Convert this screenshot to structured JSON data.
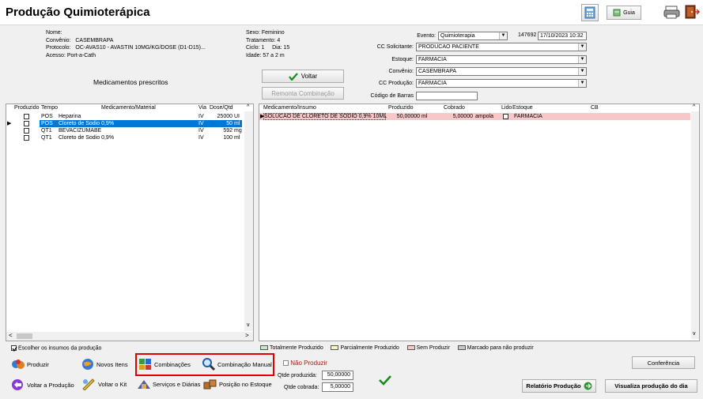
{
  "window": {
    "title": "Produção Quimioterápica"
  },
  "toolbar": {
    "guia_label": "Guia"
  },
  "patient": {
    "nome_label": "Nome:",
    "convenio_label": "Convênio:",
    "convenio": "CASEMBRAPA",
    "protocolo_label": "Protocolo:",
    "protocolo": "OC-AVAS10 - AVASTIN 10MG/KG/DOSE (D1-D15)...",
    "acesso": "Acesso: Port-a-Cath",
    "sexo": "Sexo: Feminino",
    "tratamento": "Tratamento: 4",
    "ciclo": "Ciclo: 1",
    "dia": "Dia: 15",
    "idade": "Idade: 57 a 2 m"
  },
  "form": {
    "evento_label": "Evento:",
    "evento": "Quimioterapia",
    "evento_num": "147692",
    "evento_datetime": "17/10/2023 10:32",
    "cc_solicitante_label": "CC Solicitante:",
    "cc_solicitante": "PRODUCAO PACIENTE",
    "estoque_label": "Estoque:",
    "estoque": "FARMACIA",
    "convenio_label": "Convênio:",
    "convenio": "CASEMBRAPA",
    "cc_producao_label": "CC Produção:",
    "cc_producao": "FARMACIA",
    "codigo_barras_label": "Código de Barras",
    "codigo_barras": ""
  },
  "buttons": {
    "voltar": "Voltar",
    "remonta": "Remonta Combinação",
    "produzir": "Produzir",
    "novos_itens": "Novos Itens",
    "combinacoes": "Combinações",
    "combinacao_manual": "Combinação Manual",
    "voltar_producao": "Voltar a Produção",
    "voltar_kit": "Voltar o Kit",
    "servicos_diarias": "Serviços e Diárias",
    "posicao_estoque": "Posição no Estoque",
    "conferencia": "Conferência",
    "relatorio_producao": "Relatório Produção",
    "visualiza_producao": "Visualiza produção do dia"
  },
  "left_panel": {
    "section_title": "Medicamentos prescritos",
    "columns": [
      "Produzido",
      "Tempo",
      "Medicamento/Material",
      "Via",
      "Dose/Qtd"
    ],
    "rows": [
      {
        "tempo": "POS",
        "medicamento": "Heparina",
        "via": "IV",
        "dose": "25000",
        "unit": "UI",
        "selected": false
      },
      {
        "tempo": "POS",
        "medicamento": "Cloreto de Sodio 0,9%",
        "via": "IV",
        "dose": "50",
        "unit": "ml",
        "selected": true
      },
      {
        "tempo": "QT1",
        "medicamento": "BEVACIZUMABE",
        "via": "IV",
        "dose": "592",
        "unit": "mg",
        "selected": false
      },
      {
        "tempo": "QT1",
        "medicamento": "Cloreto de Sodio 0,9%",
        "via": "IV",
        "dose": "100",
        "unit": "ml",
        "selected": false
      }
    ],
    "checkbox_label": "Escolher os insumos da produção"
  },
  "right_panel": {
    "columns": [
      "Medicamento/Insumo",
      "Produzido",
      "Cobrado",
      "Lido",
      "Estoque",
      "CB"
    ],
    "rows": [
      {
        "medicamento": "SOLUCAO DE CLORETO DE SODIO 0,9% 10ML",
        "produzido": "50,00000",
        "produzido_unit": "ml",
        "cobrado": "5,00000",
        "cobrado_unit": "ampola",
        "estoque": "FARMACIA",
        "cb": ""
      }
    ]
  },
  "legend": [
    {
      "label": "Totalmente Produzido",
      "color": "#c8e6c8"
    },
    {
      "label": "Parcialmente Produzido",
      "color": "#f4f4c0"
    },
    {
      "label": "Sem Produzir",
      "color": "#f8c8c8"
    },
    {
      "label": "Marcado para não produzir",
      "color": "#c8c8c8"
    }
  ],
  "production": {
    "nao_produzir_label": "Não Produzir",
    "qtde_produzida_label": "Qtde produzida:",
    "qtde_produzida": "50,00000",
    "qtde_cobrada_label": "Qtde cobrada:",
    "qtde_cobrada": "5,00000"
  },
  "colors": {
    "selection": "#0078d7",
    "unproduced_row": "#f8c8c8",
    "highlight_box": "#e00000",
    "check_green": "#1a8c1a"
  }
}
